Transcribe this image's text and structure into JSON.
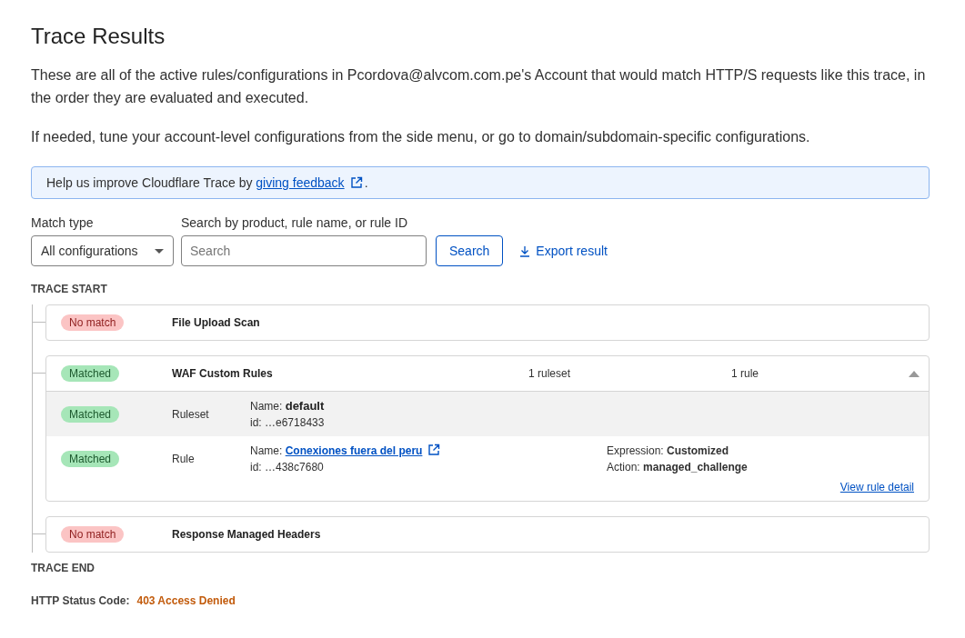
{
  "title": "Trace Results",
  "paragraphs": [
    "These are all of the active rules/configurations in Pcordova@alvcom.com.pe's Account that would match HTTP/S requests like this trace, in the order they are evaluated and executed.",
    "If needed, tune your account-level configurations from the side menu, or go to domain/subdomain-specific configurations."
  ],
  "banner": {
    "text": "Help us improve Cloudflare Trace by",
    "link": "giving feedback",
    "end": "."
  },
  "filters": {
    "match_type": {
      "label": "Match type",
      "value": "All configurations"
    },
    "search": {
      "label": "Search by product, rule name, or rule ID",
      "placeholder": "Search"
    },
    "search_button": "Search",
    "export": "Export result"
  },
  "trace_start": "TRACE START",
  "steps": [
    {
      "status": "No match",
      "matched": false,
      "name": "File Upload Scan",
      "expanded": false
    },
    {
      "status": "Matched",
      "matched": true,
      "name": "WAF Custom Rules",
      "rulesets": "1 ruleset",
      "rules": "1 rule",
      "expanded": true,
      "details": [
        {
          "kind": "ruleset",
          "status": "Matched",
          "matched": true,
          "type": "Ruleset",
          "name_label": "Name:",
          "name": "default",
          "id": "id: …e6718433"
        },
        {
          "kind": "rule",
          "status": "Matched",
          "matched": true,
          "type": "Rule",
          "name_label": "Name:",
          "name": "Conexiones fuera del peru",
          "id": "id: …438c7680",
          "expression": "Expression: **Customized**",
          "action": "Action: **managed_challenge**",
          "detail_link": "View rule detail"
        }
      ]
    },
    {
      "status": "No match",
      "matched": false,
      "name": "Response Managed Headers",
      "expanded": false
    }
  ],
  "trace_end": "TRACE END",
  "status": {
    "label": "HTTP Status Code:",
    "value": "403 Access Denied"
  }
}
